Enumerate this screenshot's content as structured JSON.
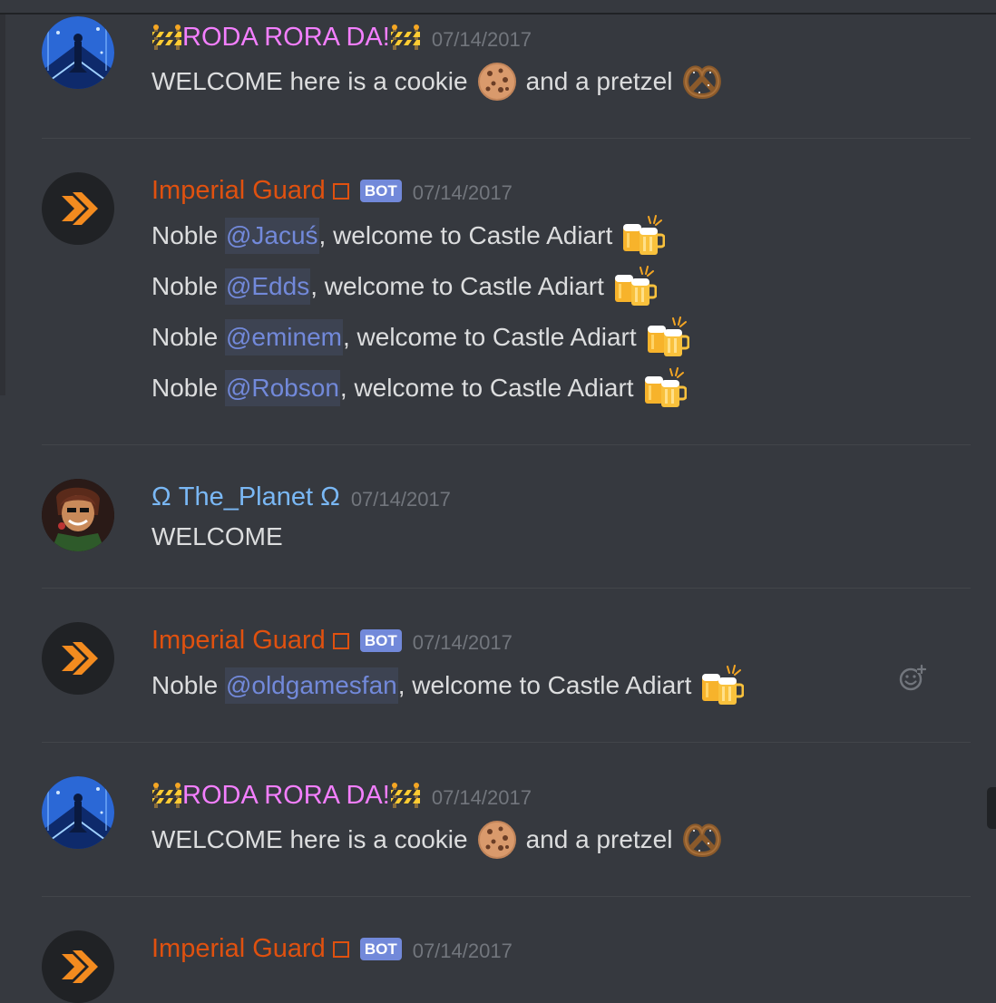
{
  "messages": [
    {
      "author": "RODA RORA DA!",
      "author_color": "#f47fff",
      "timestamp": "07/14/2017",
      "lines": [
        {
          "text1": "WELCOME here is a cookie",
          "text2": "and a pretzel"
        }
      ]
    },
    {
      "author": "Imperial Guard",
      "author_color": "#e0510f",
      "bot_tag": "BOT",
      "timestamp": "07/14/2017",
      "lines": [
        {
          "prefix": "Noble",
          "mention": "@Jacuś",
          "suffix": ", welcome to Castle Adiart"
        },
        {
          "prefix": "Noble",
          "mention": "@Edds",
          "suffix": ", welcome to Castle Adiart"
        },
        {
          "prefix": "Noble",
          "mention": "@eminem",
          "suffix": ", welcome to Castle Adiart"
        },
        {
          "prefix": "Noble",
          "mention": "@Robson",
          "suffix": ", welcome to Castle Adiart"
        }
      ]
    },
    {
      "author": "Ω The_Planet Ω",
      "author_color": "#7ab8f5",
      "timestamp": "07/14/2017",
      "lines": [
        {
          "text": "WELCOME"
        }
      ]
    },
    {
      "author": "Imperial Guard",
      "author_color": "#e0510f",
      "bot_tag": "BOT",
      "timestamp": "07/14/2017",
      "lines": [
        {
          "prefix": "Noble",
          "mention": "@oldgamesfan",
          "suffix": ", welcome to Castle Adiart"
        }
      ]
    },
    {
      "author": "RODA RORA DA!",
      "author_color": "#f47fff",
      "timestamp": "07/14/2017",
      "lines": [
        {
          "text1": "WELCOME here is a cookie",
          "text2": "and a pretzel"
        }
      ]
    },
    {
      "author": "Imperial Guard",
      "author_color": "#e0510f",
      "bot_tag": "BOT",
      "timestamp": "07/14/2017",
      "lines": []
    }
  ],
  "icons": {
    "roadblock": "construction-barrier-icon",
    "cookie": "cookie-icon",
    "pretzel": "pretzel-icon",
    "beer": "clinking-beer-mugs-icon",
    "reaction": "add-reaction-icon"
  },
  "colors": {
    "background": "#36393f",
    "mention": "#7289da",
    "text": "#dcddde",
    "timestamp": "#72767d"
  }
}
